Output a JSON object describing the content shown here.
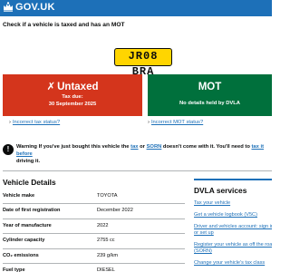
{
  "header": {
    "logo_text": "GOV.UK",
    "brand_color": "#1d70b8",
    "crown_icon": "crown-icon"
  },
  "page": {
    "title": "Check if a vehicle is taxed and has an MOT"
  },
  "vehicle": {
    "registration": "JR08 BRA",
    "plate_color": "#ffd500"
  },
  "tax_status": {
    "heading": "Untaxed",
    "icon": "cross-icon",
    "line1": "Tax due:",
    "line2": "30 September 2025",
    "color": "#d4351c",
    "link_text": "Incorrect tax status?"
  },
  "mot_status": {
    "heading": "MOT",
    "line1": "No details held by DVLA",
    "color": "#00703c",
    "link_text": "Incorrect MOT status?"
  },
  "warning": {
    "icon": "warning-icon",
    "part1": "Warning If you've just bought this vehicle the ",
    "link1": "tax",
    "part2": " or ",
    "link2": "SORN",
    "part3": " doesn't come with it. You'll need to ",
    "link3": "tax it before",
    "part4": "driving it."
  },
  "vehicle_details": {
    "title": "Vehicle Details",
    "rows": [
      {
        "label": "Vehicle make",
        "value": "TOYOTA"
      },
      {
        "label": "Date of first registration",
        "value": "December 2022"
      },
      {
        "label": "Year of manufacture",
        "value": "2022"
      },
      {
        "label": "Cylinder capacity",
        "value": "2755 cc"
      },
      {
        "label": "CO₂ emissions",
        "value": "239 g/km"
      },
      {
        "label": "Fuel type",
        "value": "DIESEL"
      }
    ]
  },
  "dvla_services": {
    "title": "DVLA services",
    "links": [
      "Tax your vehicle",
      "Get a vehicle logbook (V5C)",
      "Driver and vehicles account: sign in",
      "or set up",
      "Register your vehicle as off the road",
      "(SORN)",
      "Change your vehicle's tax class"
    ]
  }
}
